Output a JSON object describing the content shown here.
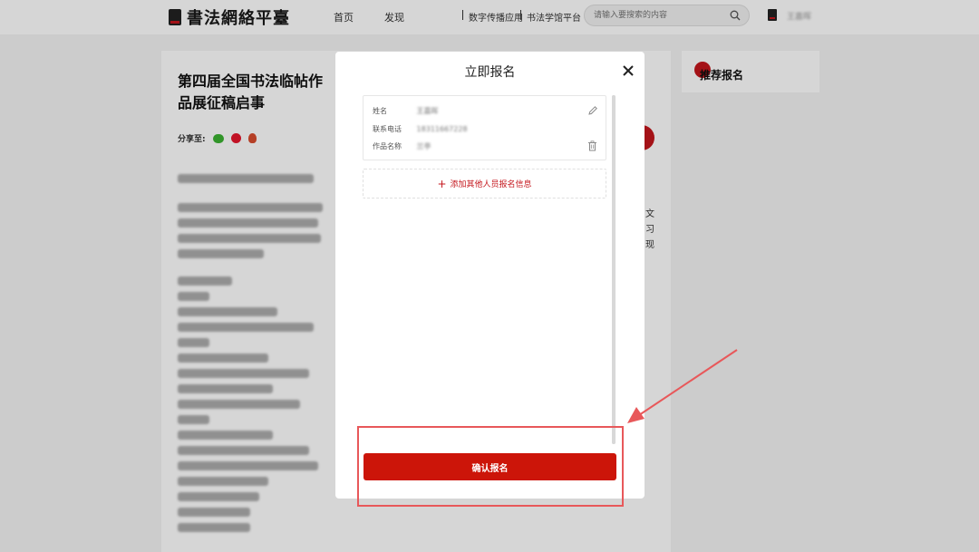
{
  "header": {
    "logo_text": "書法網絡平臺",
    "nav": [
      "首页",
      "发现"
    ],
    "links": [
      "数字传播应用",
      "书法学馆平台"
    ],
    "search_placeholder": "请输入要搜索的内容",
    "user_name": "王嘉晖"
  },
  "article": {
    "title": "第四届全国书法临帖作品展征稿启事",
    "share_label": "分享至:",
    "side_chars": [
      "文",
      "习",
      "现"
    ]
  },
  "sidebar": {
    "recommend_title": "推荐报名"
  },
  "modal": {
    "title": "立即报名",
    "fields": [
      {
        "label": "姓名",
        "value": "王嘉晖"
      },
      {
        "label": "联系电话",
        "value": "18311667228"
      },
      {
        "label": "作品名称",
        "value": "兰亭"
      }
    ],
    "add_label": "添加其他人员报名信息",
    "confirm_label": "确认报名"
  },
  "colors": {
    "brand_red": "#cc1509",
    "annotation_red": "#e8585a"
  }
}
